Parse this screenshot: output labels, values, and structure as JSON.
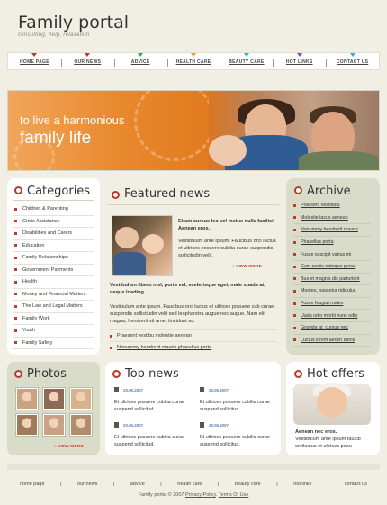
{
  "header": {
    "title": "Family portal",
    "tagline": "consulting, help, relaxation"
  },
  "nav": {
    "items": [
      {
        "label": "HOME PAGE",
        "marker_color": "#c0392b"
      },
      {
        "label": "OUR NEWS",
        "marker_color": "#c0392b"
      },
      {
        "label": "ADVICE",
        "marker_color": "#3aa348"
      },
      {
        "label": "HEALTH CARE",
        "marker_color": "#e6a10d"
      },
      {
        "label": "BEAUTY CARE",
        "marker_color": "#2bb0d6"
      },
      {
        "label": "HOT LINKS",
        "marker_color": "#9b3fb8"
      },
      {
        "label": "CONTACT US",
        "marker_color": "#2bb0d6"
      }
    ]
  },
  "banner": {
    "line1": "to live a harmonious",
    "line2": "family life"
  },
  "categories": {
    "title": "Categories",
    "items": [
      "Children & Parenting",
      "Crisis Assistance",
      "Disabilities and Carers",
      "Education",
      "Family Relationships",
      "Government Payments",
      "Health",
      "Money and Financial Matters",
      "The Law and Legal Matters",
      "Family Work",
      "Youth",
      "Family Safety"
    ]
  },
  "featured": {
    "title": "Featured news",
    "lead_bold": "Etiam cursus leo vel metus nulla facilisi. Aenean eros.",
    "lead_text": "Vestibulum ante ipsum. Faucibus orci luctus et ultrices posuere cubilia curae suspendis sollicitudin velit.",
    "more1": "VIEW MORE",
    "body_bold": "Vestibulum libero nisl, porta vel, scelerisque eget, male suada at, neque loading.",
    "body_text": "Vestibulum ante ipsum. Faucibus orci luctus et ultrices posuere cub curae suspendis sollicitudin velit sed leopharetra augue nec augue. Nam elit magna, hendrerit sit amet tincidunt ac.",
    "links": [
      "Praesent vestibu molestie aenean",
      "Nonummy hendrerit mauris phasellus porta"
    ]
  },
  "archive": {
    "title": "Archive",
    "items": [
      "Praesent vestibulu",
      "Molestie lacus aenean",
      "Nonummy hendrerit mauris",
      "Phasellus porta",
      "Fusce suscipit varius mi",
      "Cum sociis natoque penat",
      "Bus et magnis dis parturient",
      "Montes, nascetur ridiculus",
      "Fusce feugiat males",
      "Uada odio morbi nunc odio",
      "Gravida at, cursus nec",
      "Luctus lorem aecen astris"
    ]
  },
  "photos": {
    "title": "Photos",
    "more": "VIEW MORE",
    "thumb_colors": [
      "#c9a27f",
      "#8d6a58",
      "#d6b28f",
      "#a07a5a",
      "#caa08b",
      "#b28d6b"
    ]
  },
  "top_news": {
    "title": "Top news",
    "items": [
      {
        "date": "20.06.2007",
        "text": "Et ultrices posuere cubilia curae suspend sollicitud."
      },
      {
        "date": "20.06.2007",
        "text": "Et ultrices posuere cubilia curae suspend sollicitud."
      },
      {
        "date": "20.06.2007",
        "text": "Et ultrices posuere cubilia curae suspend sollicitud."
      },
      {
        "date": "20.06.2007",
        "text": "Et ultrices posuere cubilia curae suspend sollicitud."
      }
    ]
  },
  "hot_offers": {
    "title": "Hot offers",
    "bold": "Aenean nec eros.",
    "text": "Vestibulum ante ipsum faucib orciluctus et ultrices posu"
  },
  "footer": {
    "links": [
      "home page",
      "our news",
      "advice",
      "health care",
      "beauty care",
      "hot links",
      "contact us"
    ],
    "copyright_prefix": "Family portal © 2007",
    "privacy": "Privacy Policy",
    "terms": "Terms Of Use"
  }
}
